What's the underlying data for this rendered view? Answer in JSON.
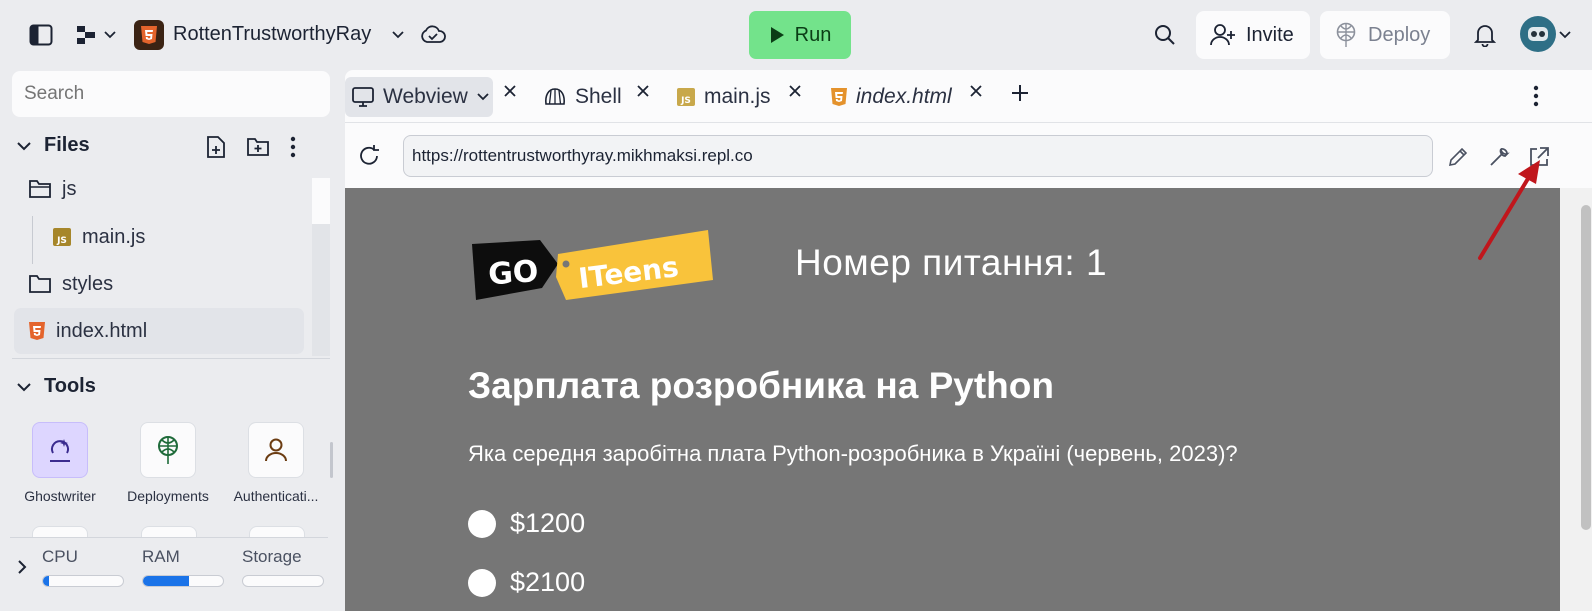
{
  "topbar": {
    "repl_name": "RottenTrustworthyRay",
    "run_label": "Run",
    "invite_label": "Invite",
    "deploy_label": "Deploy"
  },
  "sidebar": {
    "search_placeholder": "Search",
    "files_title": "Files",
    "files": [
      {
        "name": "js",
        "type": "folder"
      },
      {
        "name": "main.js",
        "type": "js"
      },
      {
        "name": "styles",
        "type": "folder"
      },
      {
        "name": "index.html",
        "type": "html"
      }
    ],
    "tools_title": "Tools",
    "tools": [
      {
        "label": "Ghostwriter",
        "icon": "ghostwriter-icon"
      },
      {
        "label": "Deployments",
        "icon": "deployments-icon"
      },
      {
        "label": "Authenticati...",
        "icon": "user-icon"
      }
    ],
    "resources": [
      {
        "label": "CPU",
        "fraction": 0.08
      },
      {
        "label": "RAM",
        "fraction": 0.57
      },
      {
        "label": "Storage",
        "fraction": 0.0
      }
    ]
  },
  "tabs": [
    {
      "label": "Webview",
      "icon": "monitor-icon"
    },
    {
      "label": "Shell",
      "icon": "shell-icon"
    },
    {
      "label": "main.js",
      "icon": "js-file-icon"
    },
    {
      "label": "index.html",
      "icon": "html-file-icon"
    }
  ],
  "webview": {
    "url": "https://rottentrustworthyray.mikhmaksi.repl.co",
    "logo_go": "GO",
    "logo_iteens": "ITeens",
    "question_number": "Номер питання: 1",
    "question_title": "Зарплата розробника на Python",
    "question_text": "Яка середня заробітна плата Python-розробника в Україні (червень, 2023)?",
    "options": [
      "$1200",
      "$2100"
    ]
  },
  "colors": {
    "run_green": "#73e38b",
    "webview_bg": "#767676",
    "annotation_arrow": "#c0161c",
    "logo_yellow": "#f9c33b"
  }
}
